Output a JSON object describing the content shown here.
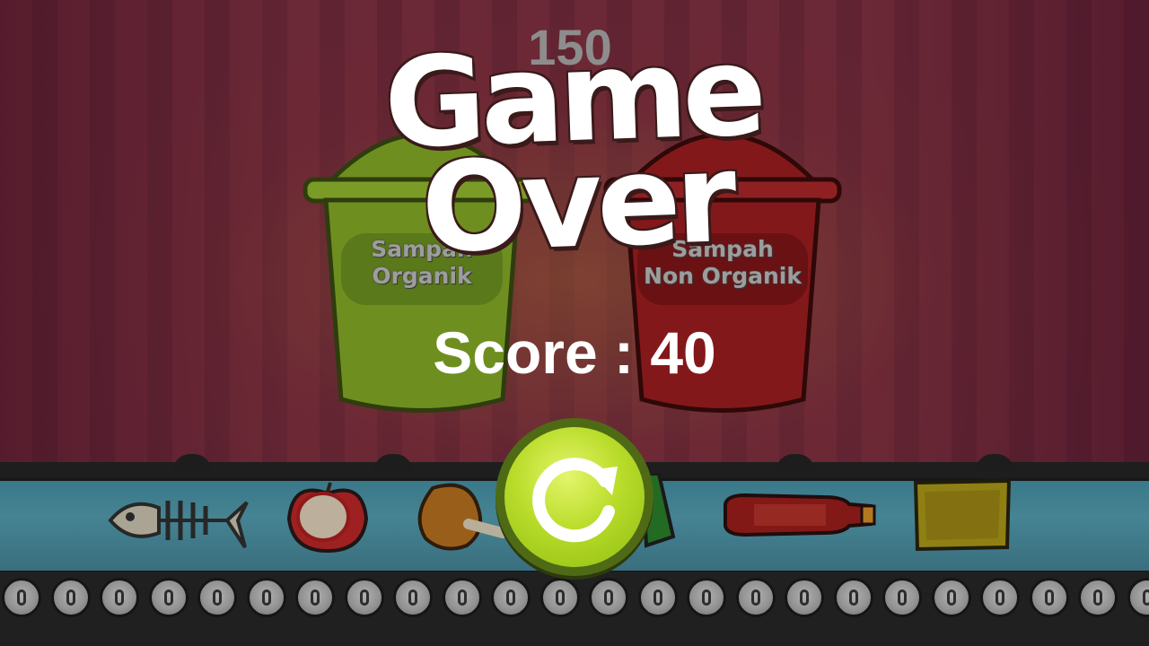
{
  "hud": {
    "top_score": "150"
  },
  "bins": {
    "organic": {
      "label_line1": "Sampah",
      "label_line2": "Organik",
      "color": "#8db82a"
    },
    "non_organic": {
      "label_line1": "Sampah",
      "label_line2": "Non Organik",
      "color": "#a81f22"
    }
  },
  "game_over": {
    "title_line1": "Game",
    "title_line2": "Over",
    "score_text": "Score : 40",
    "restart_icon": "restart-icon"
  },
  "conveyor_items": [
    "fish-bone-icon",
    "apple-icon",
    "chicken-leg-icon",
    "bottle-icon",
    "snack-pack-icon"
  ],
  "colors": {
    "belt": "#5aa9bd",
    "curtain": "#8a3446",
    "title": "#ffffff",
    "restart": "#b9dc2a"
  }
}
